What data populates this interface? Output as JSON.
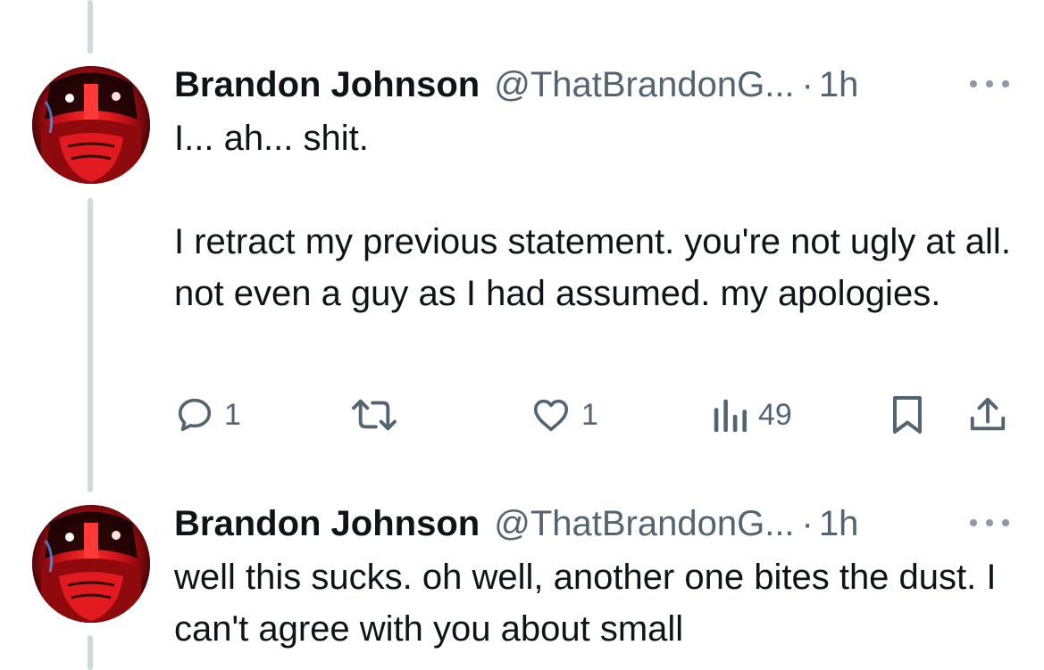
{
  "tweets": [
    {
      "author_name": "Brandon Johnson",
      "handle": "@ThatBrandonG...",
      "separator": "·",
      "time": "1h",
      "text": "I... ah... shit.\n\nI retract my previous statement. you're not ugly at all. not even a guy as I had assumed. my apologies.",
      "reply_count": "1",
      "like_count": "1",
      "view_count": "49"
    },
    {
      "author_name": "Brandon Johnson",
      "handle": "@ThatBrandonG...",
      "separator": "·",
      "time": "1h",
      "text": "well this sucks. oh well, another one bites the dust. I can't agree with you about small"
    }
  ],
  "icons": {
    "reply": "reply-icon",
    "retweet": "retweet-icon",
    "like": "heart-icon",
    "views": "views-icon",
    "bookmark": "bookmark-icon",
    "share": "share-icon",
    "more": "more-icon"
  },
  "colors": {
    "text_primary": "#0f1419",
    "text_secondary": "#536471",
    "thread_line": "#cfd9de",
    "avatar_red": "#d0141b"
  }
}
